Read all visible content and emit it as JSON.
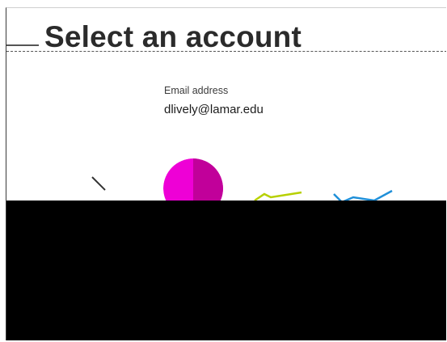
{
  "page": {
    "title": "Select an account"
  },
  "account": {
    "email_label": "Email address",
    "email_value": "dlively@lamar.edu"
  },
  "colors": {
    "avatar_light": "#ee00d6",
    "avatar_dark": "#c1009a",
    "overlay": "#000000"
  }
}
